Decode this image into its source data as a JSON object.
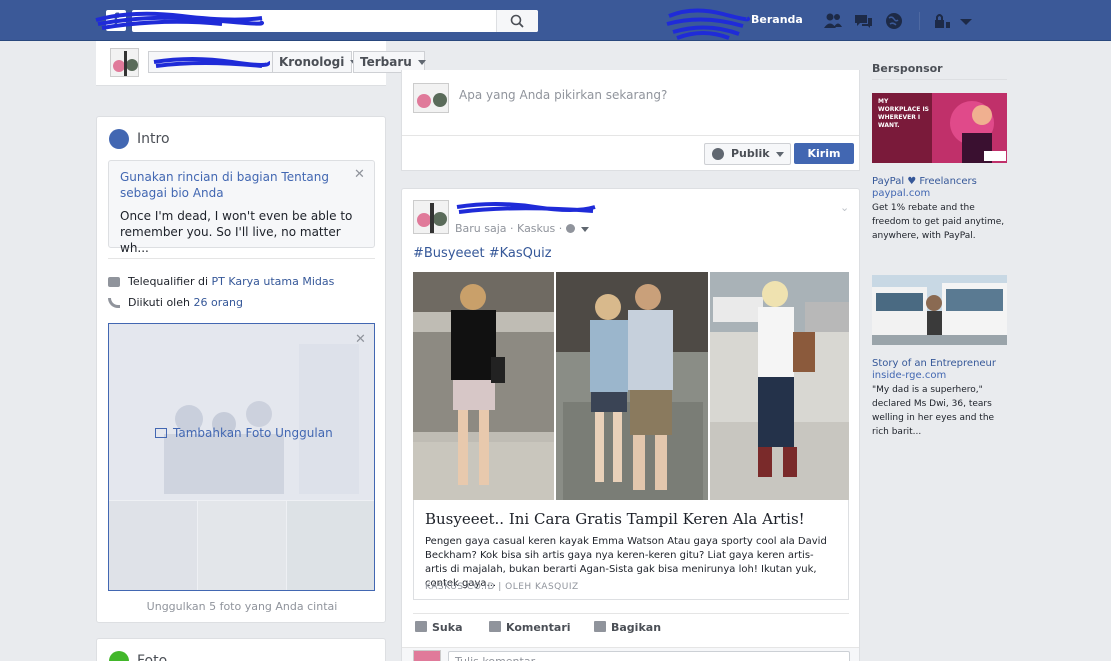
{
  "topbar": {
    "search_value": "",
    "home_label": "Beranda",
    "icons": [
      "friend-requests-icon",
      "messages-icon",
      "notifications-globe-icon",
      "privacy-shortcuts-icon",
      "account-menu-icon"
    ]
  },
  "profile_header": {
    "timeline_label": "Kronologi",
    "recent_label": "Terbaru"
  },
  "intro": {
    "title": "Intro",
    "bio_hint": "Gunakan rincian di bagian Tentang sebagai bio Anda",
    "bio_text": "Once I'm dead, I won't even be able to remember you. So I'll live, no matter wh...",
    "work_prefix": "Telequalifier di ",
    "work_link": "PT Karya utama Midas",
    "followers_prefix": "Diikuti oleh ",
    "followers_link": "26 orang",
    "featured_add": "Tambahkan Foto Unggulan",
    "featured_note": "Unggulkan 5 foto yang Anda cintai"
  },
  "photos_card": {
    "title": "Foto"
  },
  "composer": {
    "placeholder": "Apa yang Anda pikirkan sekarang?",
    "audience_label": "Publik",
    "post_label": "Kirim"
  },
  "post": {
    "time": "Baru saja",
    "app": "Kaskus",
    "text": "#Busyeeet #KasQuiz",
    "link_title": "Busyeeet.. Ini Cara Gratis Tampil Keren Ala Artis!",
    "link_desc": "Pengen gaya casual keren kayak Emma Watson Atau gaya sporty cool ala David Beckham? Kok bisa sih artis gaya nya keren-keren gitu? Liat gaya keren artis-artis di majalah, bukan berarti Agan-Sista gak bisa menirunya loh! Ikutan yuk, contek gaya...",
    "link_source": "KASKUS.CO.ID | OLEH KASQUIZ",
    "like_label": "Suka",
    "comment_label": "Komentari",
    "share_label": "Bagikan",
    "comment_placeholder": "Tulis komentar..."
  },
  "sidebar": {
    "sponsored_title": "Bersponsor",
    "ads": [
      {
        "title": "PayPal ♥ Freelancers",
        "domain": "paypal.com",
        "body": "Get 1% rebate and the freedom to get paid anytime, anywhere, with PayPal.",
        "image_text": "MY WORKPLACE IS WHEREVER I WANT."
      },
      {
        "title": "Story of an Entrepreneur",
        "domain": "inside-rge.com",
        "body": "\"My dad is a superhero,\" declared Ms Dwi, 36, tears welling in her eyes and the rich barit..."
      }
    ]
  },
  "colors": {
    "brand": "#3b5998",
    "link": "#365899",
    "button": "#4267b2",
    "background": "#e9ebee"
  }
}
